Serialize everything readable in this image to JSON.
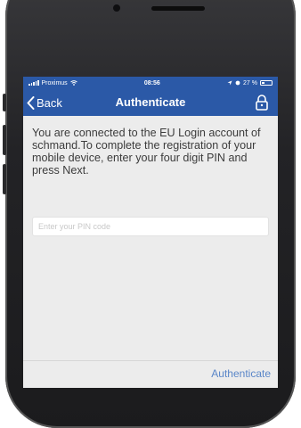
{
  "status_bar": {
    "carrier": "Proximus",
    "time": "08:56",
    "battery": "27 %",
    "icons": [
      "signal-icon",
      "wifi-icon",
      "location-icon",
      "alarm-icon",
      "battery-icon"
    ]
  },
  "nav": {
    "back_label": "Back",
    "title": "Authenticate",
    "right_icon": "lock-icon"
  },
  "body": {
    "message": "You are connected to the EU Login account of schmand.To complete the registration of your mobile device, enter your four digit PIN and press Next.",
    "pin_input": {
      "placeholder": "Enter your PIN code",
      "value": ""
    }
  },
  "footer": {
    "authenticate_label": "Authenticate"
  },
  "colors": {
    "nav_background": "#2b59a7",
    "screen_background": "#ececec",
    "link": "#5a86c8"
  }
}
